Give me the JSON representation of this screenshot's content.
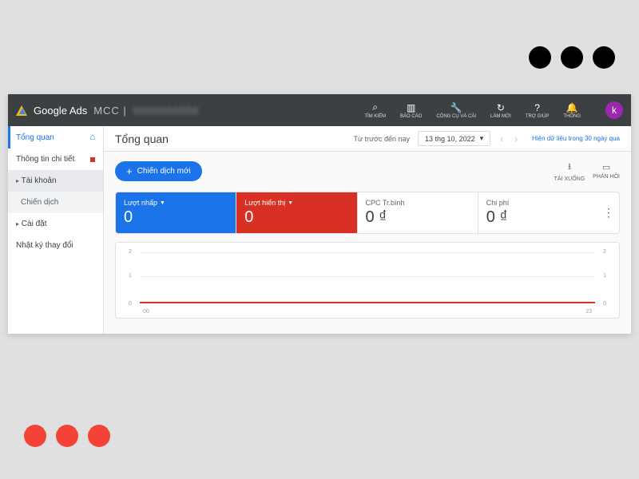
{
  "brand": "Google Ads",
  "account": "MCC |",
  "topActions": [
    {
      "icon": "⌕",
      "label": "TÌM KIẾM"
    },
    {
      "icon": "▥",
      "label": "BÁO CÁO"
    },
    {
      "icon": "🔧",
      "label": "CÔNG CỤ VÀ CÀI"
    },
    {
      "icon": "↻",
      "label": "LÀM MỚI"
    },
    {
      "icon": "?",
      "label": "TRỢ GIÚP"
    },
    {
      "icon": "🔔",
      "label": "THÔNG"
    }
  ],
  "avatar": "k",
  "sidebar": {
    "items": [
      {
        "label": "Tổng quan",
        "active": true,
        "hasHome": true
      },
      {
        "label": "Thông tin chi tiết",
        "badge": true
      },
      {
        "label": "Tài khoản",
        "expandable": true,
        "selected": true
      },
      {
        "label": "Chiến dịch",
        "sub": true
      },
      {
        "label": "Cài đặt",
        "expandable": true
      },
      {
        "label": "Nhật ký thay đổi"
      }
    ]
  },
  "header": {
    "title": "Tổng quan",
    "dateLabel": "Từ trước đến nay",
    "datePicker": "13 thg 10, 2022",
    "link": "Hiện dữ liệu trong 30 ngày qua"
  },
  "actions": {
    "newCampaign": "Chiến dịch mới",
    "download": "TẢI XUỐNG",
    "feedback": "PHẢN HỒI"
  },
  "cards": [
    {
      "label": "Lượt nhấp",
      "value": "0",
      "color": "blue",
      "dropdown": true
    },
    {
      "label": "Lượt hiển thị",
      "value": "0",
      "color": "red",
      "dropdown": true
    },
    {
      "label": "CPC Tr.bình",
      "value": "0 ₫",
      "color": "plain"
    },
    {
      "label": "Chi phí",
      "value": "0 ₫",
      "color": "plain"
    }
  ],
  "chart_data": {
    "type": "line",
    "x": [
      "00",
      "23"
    ],
    "series": [
      {
        "name": "Lượt nhấp",
        "values": [
          0,
          0
        ]
      },
      {
        "name": "Lượt hiển thị",
        "values": [
          0,
          0
        ]
      }
    ],
    "ylim_left": [
      0,
      2
    ],
    "ylim_right": [
      0,
      2
    ],
    "yticks": [
      0,
      1,
      2
    ]
  }
}
